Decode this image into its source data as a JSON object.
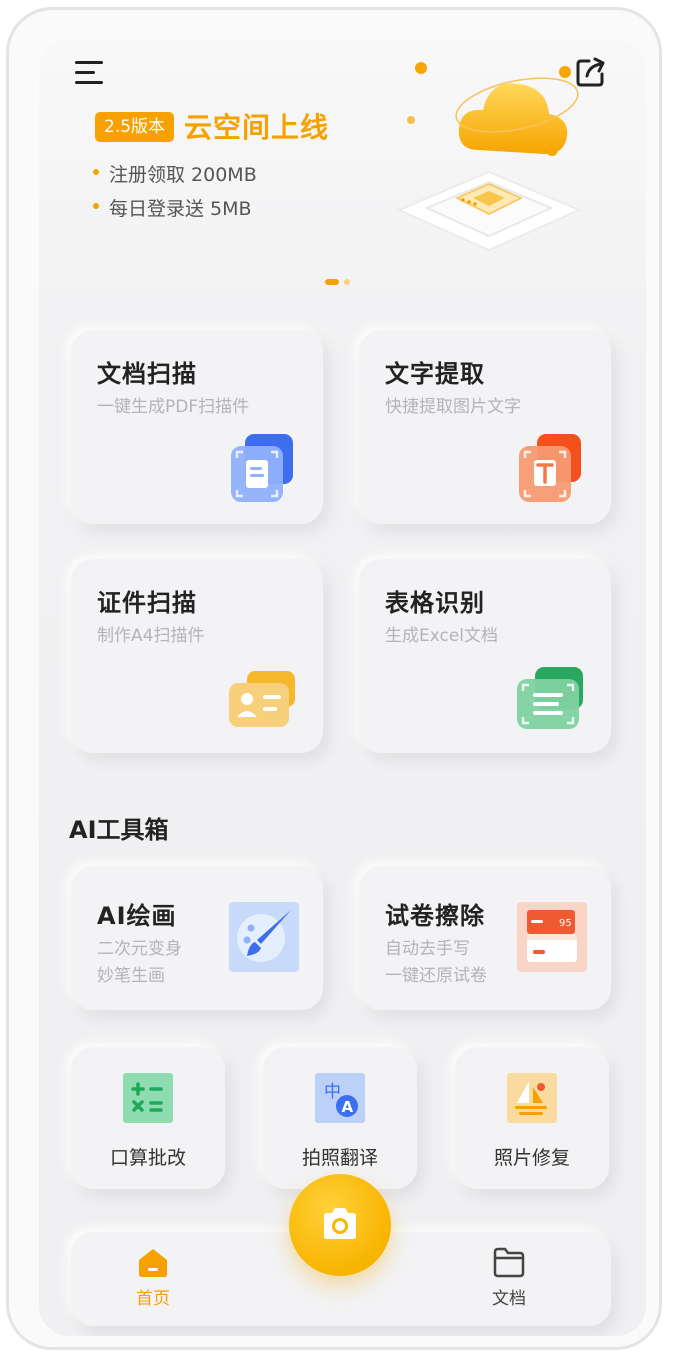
{
  "header": {
    "menu_icon": "menu-icon",
    "share_icon": "share-icon"
  },
  "banner": {
    "badge": "2.5版本",
    "title": "云空间上线",
    "bullets": [
      "注册领取 200MB",
      "每日登录送 5MB"
    ],
    "illustration": "cloud-chip-illustration",
    "page_indicator": {
      "pages": 2,
      "active": 1
    }
  },
  "features": [
    {
      "title": "文档扫描",
      "subtitle": "一键生成PDF扫描件",
      "icon": "document-scan-icon",
      "color": "#4a7df5"
    },
    {
      "title": "文字提取",
      "subtitle": "快捷提取图片文字",
      "icon": "text-extract-icon",
      "color": "#f4622d"
    },
    {
      "title": "证件扫描",
      "subtitle": "制作A4扫描件",
      "icon": "id-card-icon",
      "color": "#f5b634"
    },
    {
      "title": "表格识别",
      "subtitle": "生成Excel文档",
      "icon": "table-recognition-icon",
      "color": "#34b56a"
    }
  ],
  "ai_section": {
    "title": "AI工具箱",
    "tools": [
      {
        "title": "AI绘画",
        "subtitle_line1": "二次元变身",
        "subtitle_line2": "妙笔生画",
        "icon": "paint-palette-icon"
      },
      {
        "title": "试卷擦除",
        "subtitle_line1": "自动去手写",
        "subtitle_line2": "一键还原试卷",
        "icon": "exam-paper-icon"
      }
    ],
    "small_tools": [
      {
        "label": "口算批改",
        "icon": "calculator-icon"
      },
      {
        "label": "拍照翻译",
        "icon": "translate-icon"
      },
      {
        "label": "照片修复",
        "icon": "photo-restore-icon"
      }
    ]
  },
  "tabbar": {
    "home_label": "首页",
    "docs_label": "文档",
    "camera_icon": "camera-icon",
    "active_tab": "首页",
    "accent_color": "#f6a100"
  }
}
